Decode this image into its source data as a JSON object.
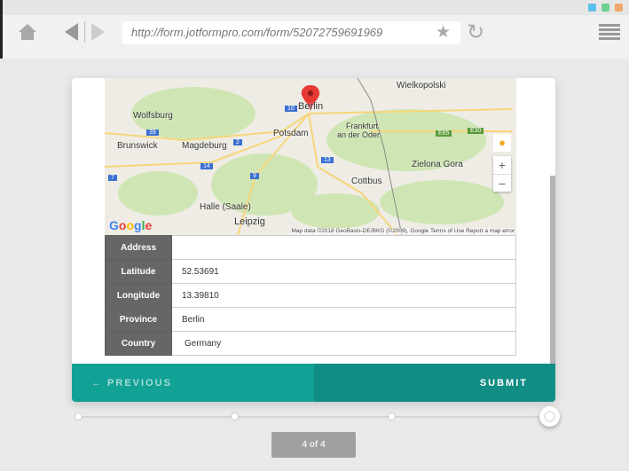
{
  "browser": {
    "url": "http://form.jotformpro.com/form/52072759691969",
    "window_buttons": [
      "#5bc0eb",
      "#6cd08e",
      "#f0a96a"
    ],
    "icons": [
      "home-icon",
      "back-icon",
      "forward-icon",
      "star-icon",
      "reload-icon",
      "menu-icon"
    ]
  },
  "map": {
    "cities": [
      "Berlin",
      "Wolfsburg",
      "Brunswick",
      "Magdeburg",
      "Potsdam",
      "Frankfurt",
      "an der Oder",
      "Wielkopolski",
      "Zielona Gora",
      "Cottbus",
      "Halle (Saale)",
      "Leipzig"
    ],
    "roads": [
      "10",
      "39",
      "2",
      "14",
      "9",
      "13",
      "7",
      "E65",
      "E30"
    ],
    "attribution": "Map data ©2018 GeoBasis-DE/BKG (©2009), Google   Terms of Use   Report a map error",
    "logo": "Google"
  },
  "fields": [
    {
      "label": "Address",
      "value": ""
    },
    {
      "label": "Latitude",
      "value": "52.53691"
    },
    {
      "label": "Longitude",
      "value": "13.39810"
    },
    {
      "label": "Province",
      "value": "Berlin"
    },
    {
      "label": "Country",
      "value": "Germany"
    }
  ],
  "footer": {
    "previous": "← PREVIOUS",
    "submit": "SUBMIT",
    "accent": "#12a195"
  },
  "progress": {
    "current": 4,
    "total": 4,
    "label": "4 of 4"
  }
}
